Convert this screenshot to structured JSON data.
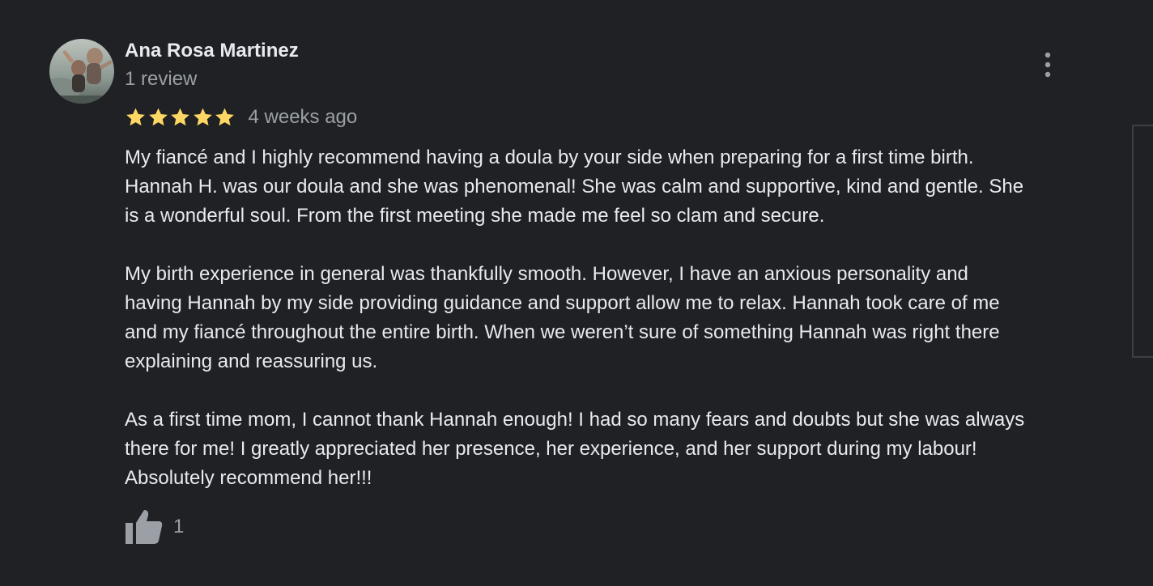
{
  "review": {
    "author_name": "Ana Rosa Martinez",
    "author_meta": "1 review",
    "rating": 5,
    "rating_max": 5,
    "date": "4 weeks ago",
    "paragraphs": [
      "My fiancé and I highly recommend having a doula by your side when preparing for a first time birth.\nHannah H. was our doula and she was phenomenal! She was calm and supportive, kind and gentle. She\nis a wonderful soul. From the first meeting she made me feel so clam and secure.",
      "My birth experience in general was thankfully smooth. However, I have an anxious personality and\nhaving Hannah by  my side providing guidance and support allow me to relax. Hannah took care of me\nand my fiancé throughout the entire birth. When we weren’t sure of something Hannah was right there\nexplaining and reassuring us.",
      "As a first time mom, I cannot thank Hannah enough! I had so many fears and doubts but she was always\nthere for me! I greatly appreciated her presence, her experience, and her support during my labour!\nAbsolutely recommend her!!!"
    ],
    "helpful_count": "1"
  },
  "icons": {
    "menu": "more-vert-icon",
    "star": "star-icon",
    "like": "thumb-up-icon"
  },
  "colors": {
    "background": "#202124",
    "primary_text": "#e8eaed",
    "secondary_text": "#9aa0a6",
    "star": "#fdd663"
  }
}
